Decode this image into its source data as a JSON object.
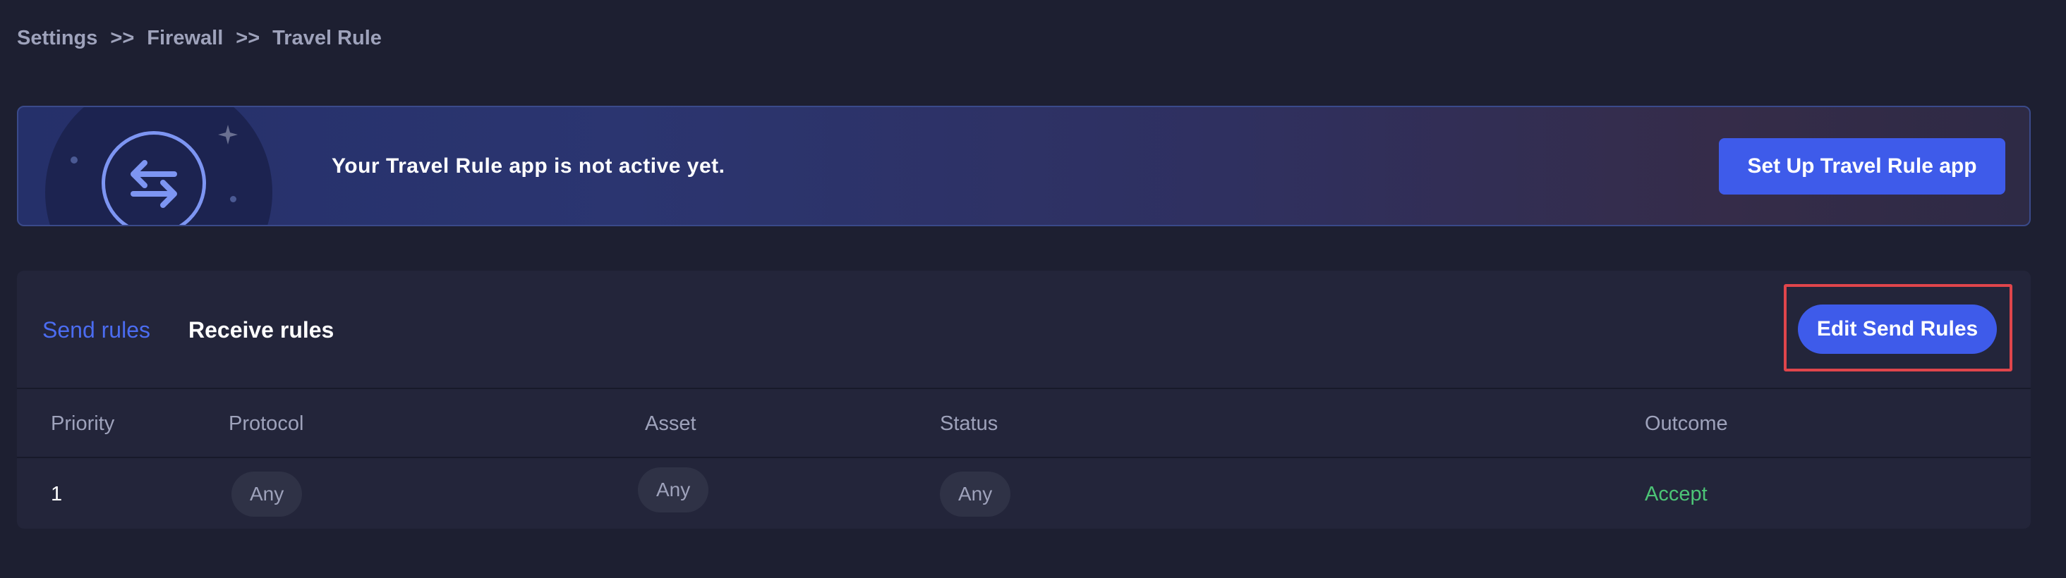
{
  "breadcrumb": {
    "items": [
      "Settings",
      "Firewall",
      "Travel Rule"
    ],
    "separator": ">>"
  },
  "banner": {
    "icon": "swap-arrows-icon",
    "message": "Your Travel Rule app is not active yet.",
    "button_label": "Set Up Travel Rule app"
  },
  "rules": {
    "tabs": [
      {
        "label": "Send rules",
        "active": true
      },
      {
        "label": "Receive rules",
        "active": false
      }
    ],
    "edit_button_label": "Edit Send Rules",
    "columns": [
      "Priority",
      "Protocol",
      "Asset",
      "Status",
      "Outcome"
    ],
    "rows": [
      {
        "priority": "1",
        "protocol": "Any",
        "asset": "Any",
        "status": "Any",
        "outcome": "Accept"
      }
    ]
  },
  "colors": {
    "accent": "#3e5bea",
    "active_tab": "#4b6cf0",
    "accept": "#4cc476",
    "highlight": "#e0454b",
    "background": "#1d1f31"
  }
}
